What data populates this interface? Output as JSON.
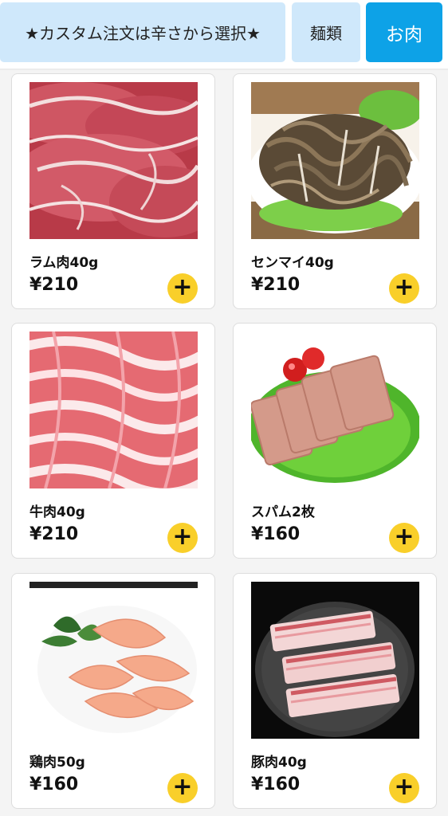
{
  "tabs": {
    "custom_label": "★カスタム注文は辛さから選択★",
    "noodles_label": "麺類",
    "meat_label": "お肉",
    "active_color": "#0da2e7",
    "inactive_color": "#cfe8fb"
  },
  "products": [
    {
      "name": "ラム肉40g",
      "price": "¥210",
      "image": "lamb-slices",
      "add_icon": "plus-icon"
    },
    {
      "name": "センマイ40g",
      "price": "¥210",
      "image": "beef-tripe",
      "add_icon": "plus-icon"
    },
    {
      "name": "牛肉40g",
      "price": "¥210",
      "image": "beef-slices",
      "add_icon": "plus-icon"
    },
    {
      "name": "スパム2枚",
      "price": "¥160",
      "image": "spam-slices",
      "add_icon": "plus-icon"
    },
    {
      "name": "鶏肉50g",
      "price": "¥160",
      "image": "chicken-slices",
      "add_icon": "plus-icon"
    },
    {
      "name": "豚肉40g",
      "price": "¥160",
      "image": "pork-belly",
      "add_icon": "plus-icon"
    }
  ],
  "accent_add_color": "#f9cf2a"
}
